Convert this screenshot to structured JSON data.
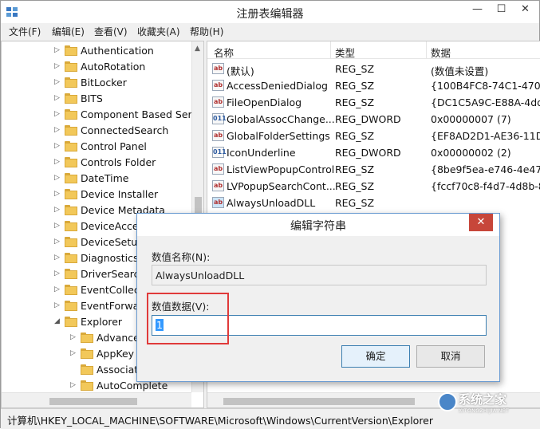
{
  "window": {
    "title": "注册表编辑器",
    "minimize": "—",
    "maximize": "☐",
    "close": "✕"
  },
  "menu": [
    "文件(F)",
    "编辑(E)",
    "查看(V)",
    "收藏夹(A)",
    "帮助(H)"
  ],
  "tree": {
    "items": [
      {
        "label": "Authentication",
        "expander": "▷",
        "depth": 0
      },
      {
        "label": "AutoRotation",
        "expander": "▷",
        "depth": 0
      },
      {
        "label": "BitLocker",
        "expander": "▷",
        "depth": 0
      },
      {
        "label": "BITS",
        "expander": "▷",
        "depth": 0
      },
      {
        "label": "Component Based Serv",
        "expander": "▷",
        "depth": 0
      },
      {
        "label": "ConnectedSearch",
        "expander": "▷",
        "depth": 0
      },
      {
        "label": "Control Panel",
        "expander": "▷",
        "depth": 0
      },
      {
        "label": "Controls Folder",
        "expander": "▷",
        "depth": 0
      },
      {
        "label": "DateTime",
        "expander": "▷",
        "depth": 0
      },
      {
        "label": "Device Installer",
        "expander": "▷",
        "depth": 0
      },
      {
        "label": "Device Metadata",
        "expander": "▷",
        "depth": 0
      },
      {
        "label": "DeviceAcces",
        "expander": "▷",
        "depth": 0
      },
      {
        "label": "DeviceSetup",
        "expander": "▷",
        "depth": 0
      },
      {
        "label": "Diagnostics",
        "expander": "▷",
        "depth": 0
      },
      {
        "label": "DriverSearch",
        "expander": "▷",
        "depth": 0
      },
      {
        "label": "EventCollect",
        "expander": "▷",
        "depth": 0
      },
      {
        "label": "EventForwar",
        "expander": "▷",
        "depth": 0
      },
      {
        "label": "Explorer",
        "expander": "◢",
        "depth": 0
      },
      {
        "label": "Advanced",
        "expander": "▷",
        "depth": 1
      },
      {
        "label": "AppKey",
        "expander": "▷",
        "depth": 1
      },
      {
        "label": "Associatio",
        "expander": "",
        "depth": 1
      },
      {
        "label": "AutoComplete",
        "expander": "▷",
        "depth": 1
      }
    ]
  },
  "list": {
    "headers": [
      "名称",
      "类型",
      "数据"
    ],
    "rows": [
      {
        "icon": "ab",
        "kind": "sz",
        "name": "(默认)",
        "type": "REG_SZ",
        "data": "(数值未设置)"
      },
      {
        "icon": "ab",
        "kind": "sz",
        "name": "AccessDeniedDialog",
        "type": "REG_SZ",
        "data": "{100B4FC8-74C1-470F-"
      },
      {
        "icon": "ab",
        "kind": "sz",
        "name": "FileOpenDialog",
        "type": "REG_SZ",
        "data": "{DC1C5A9C-E88A-4dd"
      },
      {
        "icon": "011",
        "kind": "dw",
        "name": "GlobalAssocChange...",
        "type": "REG_DWORD",
        "data": "0x00000007 (7)"
      },
      {
        "icon": "ab",
        "kind": "sz",
        "name": "GlobalFolderSettings",
        "type": "REG_SZ",
        "data": "{EF8AD2D1-AE36-11D1"
      },
      {
        "icon": "011",
        "kind": "dw",
        "name": "IconUnderline",
        "type": "REG_DWORD",
        "data": "0x00000002 (2)"
      },
      {
        "icon": "ab",
        "kind": "sz",
        "name": "ListViewPopupControl",
        "type": "REG_SZ",
        "data": "{8be9f5ea-e746-4e47-"
      },
      {
        "icon": "ab",
        "kind": "sz",
        "name": "LVPopupSearchCont...",
        "type": "REG_SZ",
        "data": "{fccf70c8-f4d7-4d8b-8"
      },
      {
        "icon": "ab",
        "kind": "hl",
        "name": "AlwaysUnloadDLL",
        "type": "REG_SZ",
        "data": ""
      }
    ]
  },
  "status": {
    "path": "计算机\\HKEY_LOCAL_MACHINE\\SOFTWARE\\Microsoft\\Windows\\CurrentVersion\\Explorer"
  },
  "dialog": {
    "title": "编辑字符串",
    "close": "✕",
    "name_label": "数值名称(N):",
    "name_value": "AlwaysUnloadDLL",
    "data_label": "数值数据(V):",
    "data_value": "1",
    "ok": "确定",
    "cancel": "取消"
  },
  "watermark": {
    "text": "系统之家",
    "sub": "XITONGZHIJIA.NET"
  }
}
